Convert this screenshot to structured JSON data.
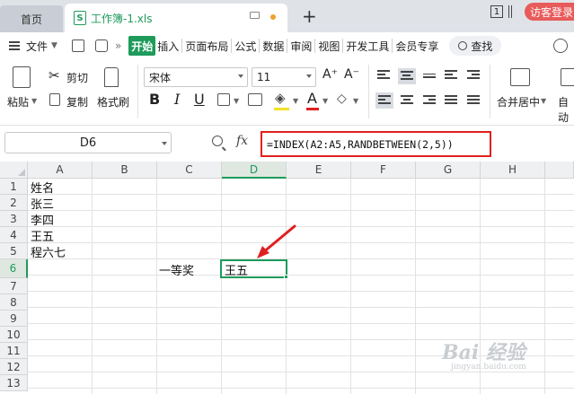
{
  "tabs": {
    "home_label": "首页",
    "file_icon_label": "S",
    "file_name": "工作簿-1.xls",
    "new_tab_label": "+",
    "window_count": "1",
    "visitor_button": "访客登录"
  },
  "menu": {
    "file_label": "文件",
    "items": [
      "开始",
      "插入",
      "页面布局",
      "公式",
      "数据",
      "审阅",
      "视图",
      "开发工具",
      "会员专享"
    ],
    "active_item": "开始",
    "search_label": "查找"
  },
  "ribbon": {
    "paste_label": "粘贴",
    "cut_label": "剪切",
    "copy_label": "复制",
    "format_painter_label": "格式刷",
    "font_name": "宋体",
    "font_size": "11",
    "bold": "B",
    "italic": "I",
    "underline": "U",
    "font_grow": "A⁺",
    "font_shrink": "A⁻",
    "merge_center_label": "合并居中",
    "auto_wrap_label": "自动"
  },
  "formula_bar": {
    "name_box": "D6",
    "fx_label": "fx",
    "formula": "=INDEX(A2:A5,RANDBETWEEN(2,5))"
  },
  "grid": {
    "columns": [
      "A",
      "B",
      "C",
      "D",
      "E",
      "F",
      "G",
      "H"
    ],
    "rows": [
      "1",
      "2",
      "3",
      "4",
      "5",
      "6",
      "7",
      "8",
      "9",
      "10",
      "11",
      "12",
      "13"
    ],
    "selected_column": "D",
    "selected_row": "6",
    "cells": {
      "A1": "姓名",
      "A2": "张三",
      "A3": "李四",
      "A4": "王五",
      "A5": "程六七",
      "C6": "一等奖",
      "D6": "王五"
    }
  },
  "annotation": {
    "arrow_color": "#e02020",
    "highlight_color": "#e02020"
  },
  "colors": {
    "accent_green": "#1e9b5b",
    "visitor_red": "#e85b5b"
  },
  "watermark": {
    "main": "Bai 经验",
    "sub": "jingyan.baidu.com"
  }
}
